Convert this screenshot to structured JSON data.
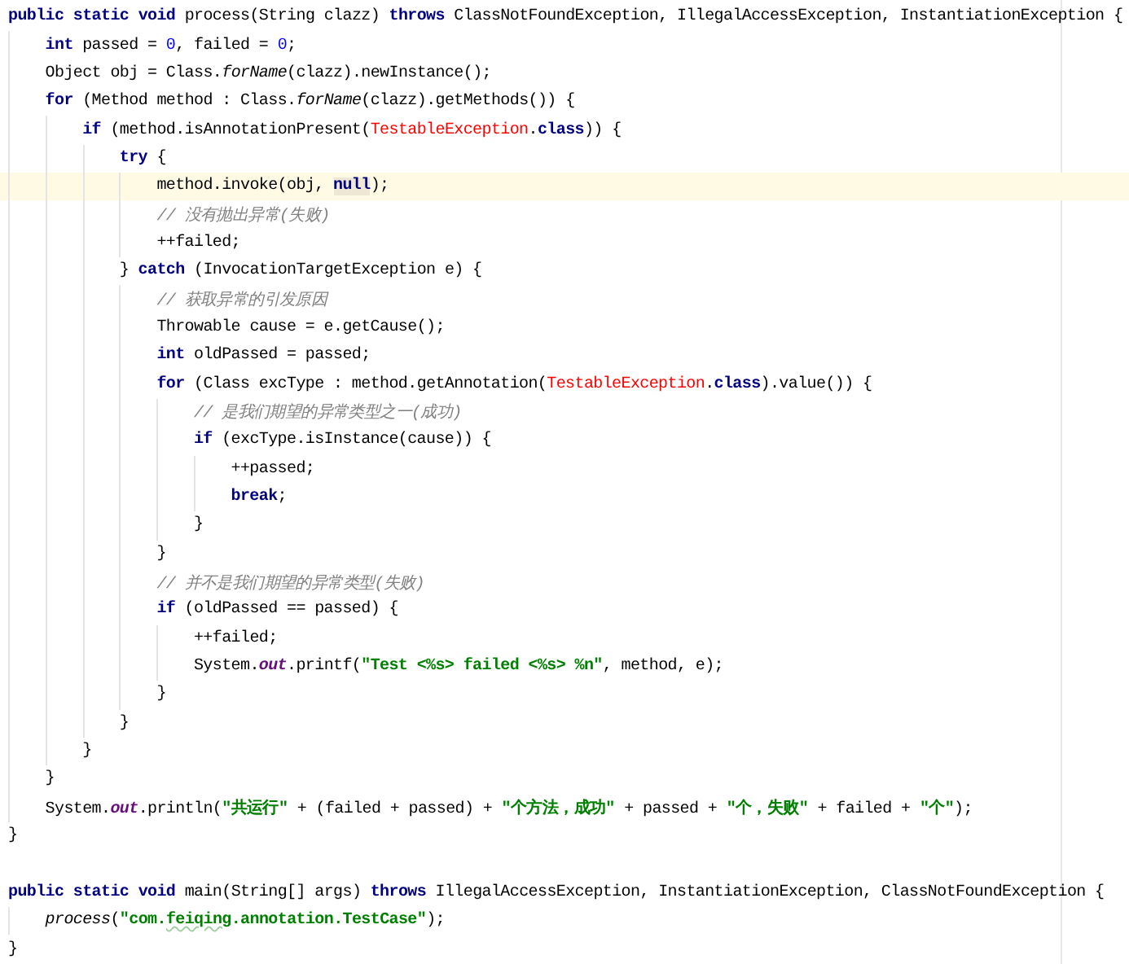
{
  "editor": {
    "lines": [
      {
        "current": false,
        "tokens": [
          {
            "text": "public static void",
            "kind": "keyword"
          },
          {
            "text": " process(String clazz) ",
            "kind": "plain"
          },
          {
            "text": "throws",
            "kind": "keyword"
          },
          {
            "text": " ClassNotFoundException, IllegalAccessException, InstantiationException {",
            "kind": "plain"
          }
        ]
      },
      {
        "current": false,
        "tokens": [
          {
            "text": "    int",
            "kind": "keyword"
          },
          {
            "text": " passed = ",
            "kind": "plain"
          },
          {
            "text": "0",
            "kind": "number"
          },
          {
            "text": ", failed = ",
            "kind": "plain"
          },
          {
            "text": "0",
            "kind": "number"
          },
          {
            "text": ";",
            "kind": "plain"
          }
        ]
      },
      {
        "current": false,
        "tokens": [
          {
            "text": "    Object obj = Class.",
            "kind": "plain"
          },
          {
            "text": "forName",
            "kind": "static"
          },
          {
            "text": "(clazz).newInstance();",
            "kind": "plain"
          }
        ]
      },
      {
        "current": false,
        "tokens": [
          {
            "text": "    for",
            "kind": "keyword"
          },
          {
            "text": " (Method method : Class.",
            "kind": "plain"
          },
          {
            "text": "forName",
            "kind": "static"
          },
          {
            "text": "(clazz).getMethods()) {",
            "kind": "plain"
          }
        ]
      },
      {
        "current": false,
        "tokens": [
          {
            "text": "        if",
            "kind": "keyword"
          },
          {
            "text": " (method.isAnnotationPresent(",
            "kind": "plain"
          },
          {
            "text": "TestableException",
            "kind": "error"
          },
          {
            "text": ".",
            "kind": "plain"
          },
          {
            "text": "class",
            "kind": "keyword"
          },
          {
            "text": ")) {",
            "kind": "plain"
          }
        ]
      },
      {
        "current": false,
        "tokens": [
          {
            "text": "            try",
            "kind": "keyword"
          },
          {
            "text": " {",
            "kind": "plain"
          }
        ]
      },
      {
        "current": true,
        "tokens": [
          {
            "text": "                method.invoke(obj, ",
            "kind": "plain"
          },
          {
            "text": "null",
            "kind": "match"
          },
          {
            "text": ");",
            "kind": "plain"
          }
        ]
      },
      {
        "current": false,
        "tokens": [
          {
            "text": "                // 没有抛出异常(失败)",
            "kind": "comment"
          }
        ]
      },
      {
        "current": false,
        "tokens": [
          {
            "text": "                ++failed;",
            "kind": "plain"
          }
        ]
      },
      {
        "current": false,
        "tokens": [
          {
            "text": "            } ",
            "kind": "plain"
          },
          {
            "text": "catch",
            "kind": "keyword"
          },
          {
            "text": " (InvocationTargetException e) {",
            "kind": "plain"
          }
        ]
      },
      {
        "current": false,
        "tokens": [
          {
            "text": "                // 获取异常的引发原因",
            "kind": "comment"
          }
        ]
      },
      {
        "current": false,
        "tokens": [
          {
            "text": "                Throwable cause = e.getCause();",
            "kind": "plain"
          }
        ]
      },
      {
        "current": false,
        "tokens": [
          {
            "text": "                int",
            "kind": "keyword"
          },
          {
            "text": " oldPassed = passed;",
            "kind": "plain"
          }
        ]
      },
      {
        "current": false,
        "tokens": [
          {
            "text": "                for",
            "kind": "keyword"
          },
          {
            "text": " (Class excType : method.getAnnotation(",
            "kind": "plain"
          },
          {
            "text": "TestableException",
            "kind": "error"
          },
          {
            "text": ".",
            "kind": "plain"
          },
          {
            "text": "class",
            "kind": "keyword"
          },
          {
            "text": ").value()) {",
            "kind": "plain"
          }
        ]
      },
      {
        "current": false,
        "tokens": [
          {
            "text": "                    // 是我们期望的异常类型之一(成功)",
            "kind": "comment"
          }
        ]
      },
      {
        "current": false,
        "tokens": [
          {
            "text": "                    if",
            "kind": "keyword"
          },
          {
            "text": " (excType.isInstance(cause)) {",
            "kind": "plain"
          }
        ]
      },
      {
        "current": false,
        "tokens": [
          {
            "text": "                        ++passed;",
            "kind": "plain"
          }
        ]
      },
      {
        "current": false,
        "tokens": [
          {
            "text": "                        break",
            "kind": "keyword"
          },
          {
            "text": ";",
            "kind": "plain"
          }
        ]
      },
      {
        "current": false,
        "tokens": [
          {
            "text": "                    }",
            "kind": "plain"
          }
        ]
      },
      {
        "current": false,
        "tokens": [
          {
            "text": "                }",
            "kind": "plain"
          }
        ]
      },
      {
        "current": false,
        "tokens": [
          {
            "text": "                // 并不是我们期望的异常类型(失败)",
            "kind": "comment"
          }
        ]
      },
      {
        "current": false,
        "tokens": [
          {
            "text": "                if",
            "kind": "keyword"
          },
          {
            "text": " (oldPassed == passed) {",
            "kind": "plain"
          }
        ]
      },
      {
        "current": false,
        "tokens": [
          {
            "text": "                    ++failed;",
            "kind": "plain"
          }
        ]
      },
      {
        "current": false,
        "tokens": [
          {
            "text": "                    System.",
            "kind": "plain"
          },
          {
            "text": "out",
            "kind": "field"
          },
          {
            "text": ".printf(",
            "kind": "plain"
          },
          {
            "text": "\"Test <%s> failed <%s> %n\"",
            "kind": "string"
          },
          {
            "text": ", method, e);",
            "kind": "plain"
          }
        ]
      },
      {
        "current": false,
        "tokens": [
          {
            "text": "                }",
            "kind": "plain"
          }
        ]
      },
      {
        "current": false,
        "tokens": [
          {
            "text": "            }",
            "kind": "plain"
          }
        ]
      },
      {
        "current": false,
        "tokens": [
          {
            "text": "        }",
            "kind": "plain"
          }
        ]
      },
      {
        "current": false,
        "tokens": [
          {
            "text": "    }",
            "kind": "plain"
          }
        ]
      },
      {
        "current": false,
        "tokens": [
          {
            "text": "    System.",
            "kind": "plain"
          },
          {
            "text": "out",
            "kind": "field"
          },
          {
            "text": ".println(",
            "kind": "plain"
          },
          {
            "text": "\"共运行\"",
            "kind": "string"
          },
          {
            "text": " + (failed + passed) + ",
            "kind": "plain"
          },
          {
            "text": "\"个方法，成功\"",
            "kind": "string"
          },
          {
            "text": " + passed + ",
            "kind": "plain"
          },
          {
            "text": "\"个，失败\"",
            "kind": "string"
          },
          {
            "text": " + failed + ",
            "kind": "plain"
          },
          {
            "text": "\"个\"",
            "kind": "string"
          },
          {
            "text": ");",
            "kind": "plain"
          }
        ]
      },
      {
        "current": false,
        "tokens": [
          {
            "text": "}",
            "kind": "plain"
          }
        ]
      },
      {
        "current": false
      },
      {
        "current": false,
        "tokens": [
          {
            "text": "public static void",
            "kind": "keyword"
          },
          {
            "text": " main(String[] args) ",
            "kind": "plain"
          },
          {
            "text": "throws",
            "kind": "keyword"
          },
          {
            "text": " IllegalAccessException, InstantiationException, ClassNotFoundException {",
            "kind": "plain"
          }
        ]
      },
      {
        "current": false,
        "tokens": [
          {
            "text": "    process",
            "kind": "static"
          },
          {
            "text": "(",
            "kind": "plain"
          },
          {
            "text": "\"com.",
            "kind": "string"
          },
          {
            "text": "feiqing",
            "kind": "typo"
          },
          {
            "text": ".annotation.TestCase\"",
            "kind": "string"
          },
          {
            "text": ");",
            "kind": "plain"
          }
        ]
      },
      {
        "current": false,
        "tokens": [
          {
            "text": "}",
            "kind": "plain"
          }
        ]
      }
    ]
  }
}
